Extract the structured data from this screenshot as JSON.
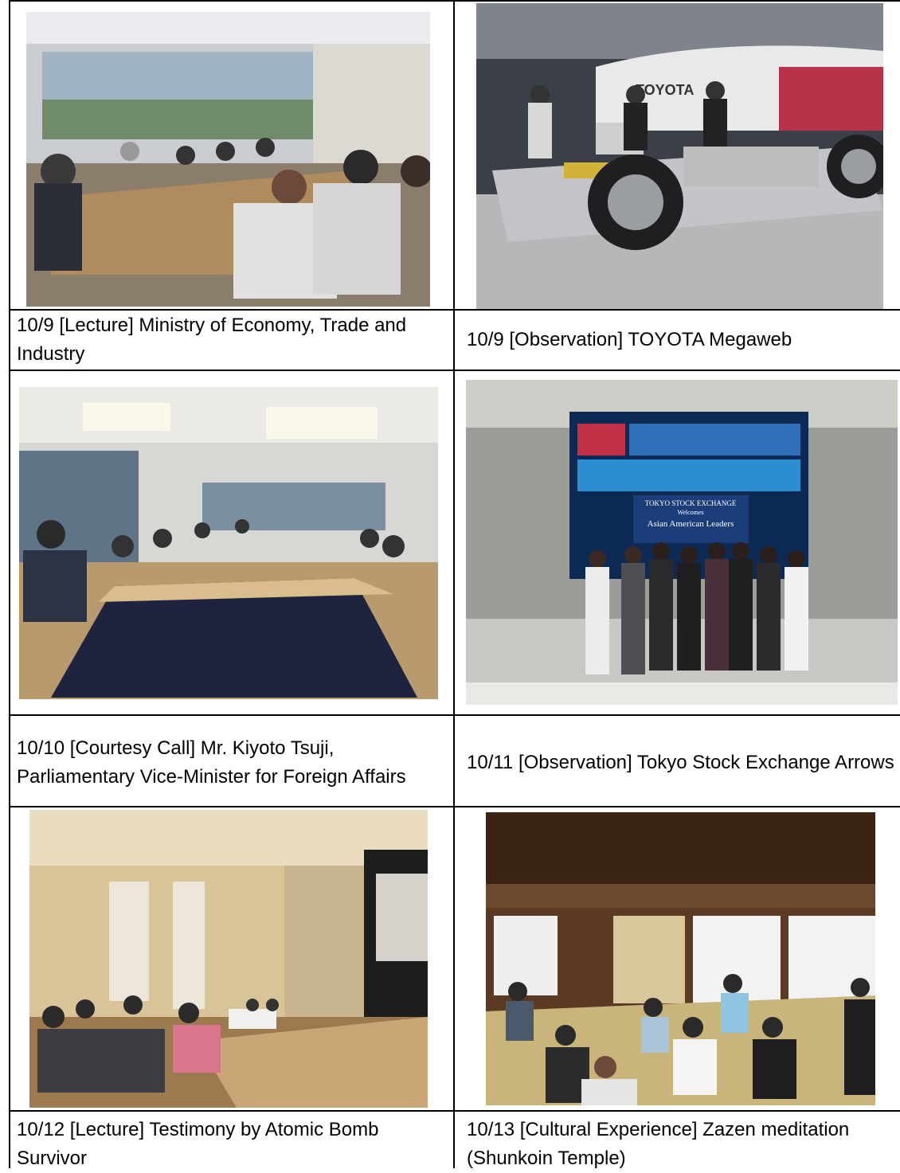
{
  "cells": [
    {
      "caption": "10/9 [Lecture] Ministry of Economy, Trade and Industry",
      "photo_subject": "meeting-room-lecture-photo"
    },
    {
      "caption": "10/9 [Observation] TOYOTA Megaweb",
      "photo_subject": "car-chassis-exhibit-photo",
      "sign_text": "TOYOTA"
    },
    {
      "caption": "10/10 [Courtesy Call] Mr. Kiyoto Tsuji, Parliamentary Vice-Minister for Foreign Affairs",
      "photo_subject": "conference-table-photo"
    },
    {
      "caption": "10/11 [Observation] Tokyo Stock Exchange Arrows",
      "photo_subject": "stock-exchange-group-photo",
      "screen_text": [
        "TOKYO STOCK EXCHANGE",
        "Welcomes",
        "Asian American Leaders"
      ]
    },
    {
      "caption": "10/12 [Lecture] Testimony by Atomic Bomb Survivor",
      "photo_subject": "auditorium-lecture-photo"
    },
    {
      "caption": "10/13 [Cultural Experience] Zazen meditation (Shunkoin Temple)",
      "photo_subject": "temple-tatami-room-photo"
    }
  ],
  "colors": {
    "border": "#000000",
    "background": "#ffffff",
    "text": "#000000"
  }
}
